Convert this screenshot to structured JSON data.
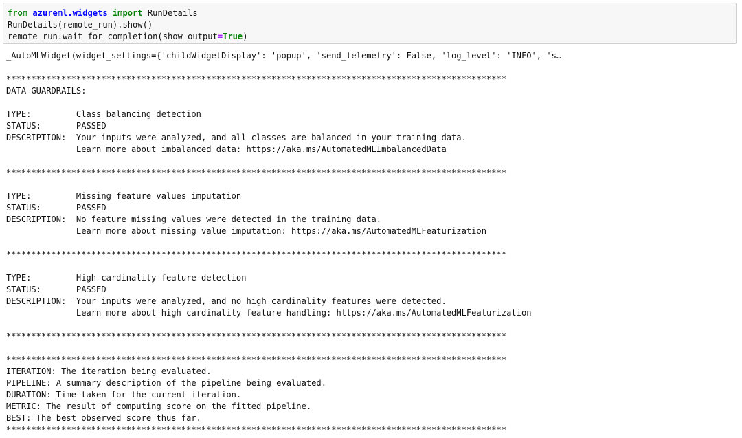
{
  "code": {
    "line1": {
      "kw1": "from",
      "module": "azureml.widgets",
      "kw2": "import",
      "name": "RunDetails"
    },
    "line2": "RunDetails(remote_run).show()",
    "line3": {
      "pre": "remote_run.wait_for_completion(show_output",
      "eq": "=",
      "kw": "True",
      "post": ")"
    }
  },
  "output": {
    "lines": [
      "_AutoMLWidget(widget_settings={'childWidgetDisplay': 'popup', 'send_telemetry': False, 'log_level': 'INFO', 's…",
      "",
      "****************************************************************************************************",
      "DATA GUARDRAILS: ",
      "",
      "TYPE:         Class balancing detection",
      "STATUS:       PASSED",
      "DESCRIPTION:  Your inputs were analyzed, and all classes are balanced in your training data.",
      "              Learn more about imbalanced data: https://aka.ms/AutomatedMLImbalancedData",
      "",
      "****************************************************************************************************",
      "",
      "TYPE:         Missing feature values imputation",
      "STATUS:       PASSED",
      "DESCRIPTION:  No feature missing values were detected in the training data.",
      "              Learn more about missing value imputation: https://aka.ms/AutomatedMLFeaturization",
      "",
      "****************************************************************************************************",
      "",
      "TYPE:         High cardinality feature detection",
      "STATUS:       PASSED",
      "DESCRIPTION:  Your inputs were analyzed, and no high cardinality features were detected.",
      "              Learn more about high cardinality feature handling: https://aka.ms/AutomatedMLFeaturization",
      "",
      "****************************************************************************************************",
      "",
      "****************************************************************************************************",
      "ITERATION: The iteration being evaluated.",
      "PIPELINE: A summary description of the pipeline being evaluated.",
      "DURATION: Time taken for the current iteration.",
      "METRIC: The result of computing score on the fitted pipeline.",
      "BEST: The best observed score thus far.",
      "****************************************************************************************************"
    ]
  }
}
